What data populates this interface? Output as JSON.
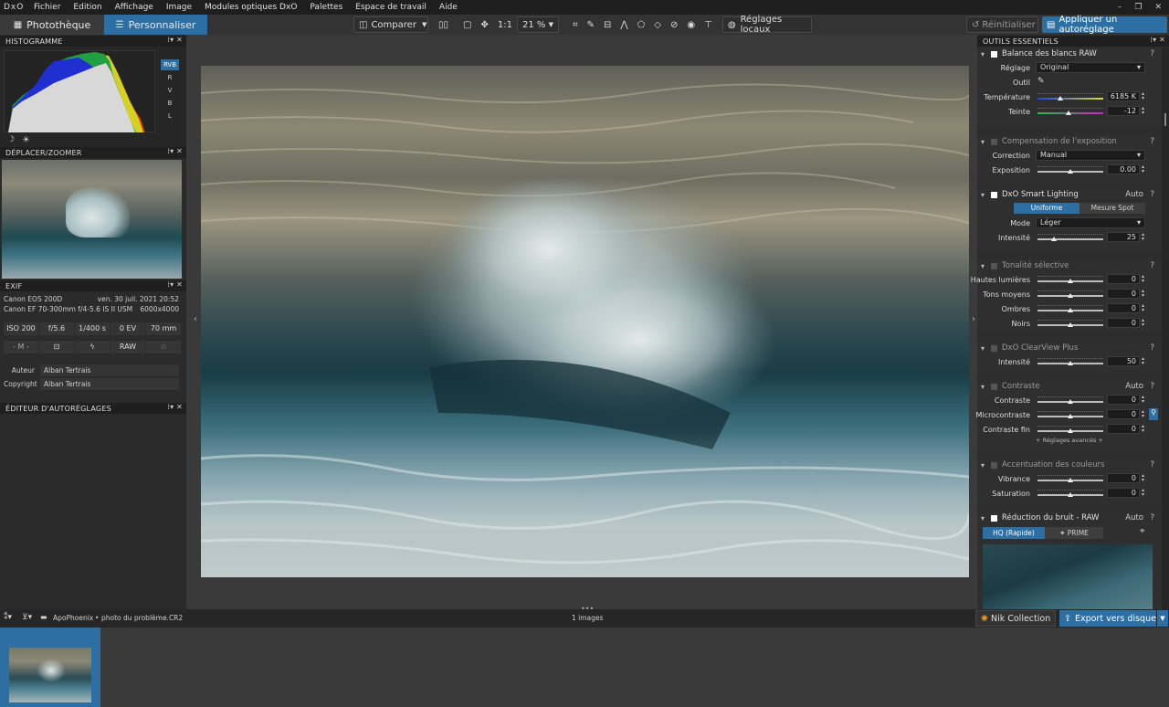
{
  "menubar": {
    "logo": "DxO",
    "items": [
      "Fichier",
      "Edition",
      "Affichage",
      "Image",
      "Modules optiques DxO",
      "Palettes",
      "Espace de travail",
      "Aide"
    ]
  },
  "toolbar": {
    "tab_library": "Photothèque",
    "tab_customize": "Personnaliser",
    "compare": "Comparer",
    "ratio": "1:1",
    "zoom": "21 %",
    "local_adjust": "Réglages locaux",
    "reset": "Réinitialiser",
    "apply_preset": "Appliquer un autoréglage"
  },
  "left": {
    "histogram_title": "HISTOGRAMME",
    "channels": [
      "RVB",
      "R",
      "V",
      "B",
      "L"
    ],
    "move_zoom_title": "DÉPLACER/ZOOMER",
    "exif_title": "EXIF",
    "camera": "Canon EOS 200D",
    "date": "ven. 30 juil. 2021 20:52",
    "lens": "Canon EF 70-300mm f/4-5.6 IS II USM",
    "size": "6000x4000",
    "iso": "ISO 200",
    "aperture": "f/5.6",
    "shutter": "1/400 s",
    "ev": "0 EV",
    "focal": "70 mm",
    "mode": "- M -",
    "format": "RAW",
    "author_label": "Auteur",
    "author": "Alban Tertrais",
    "copyright_label": "Copyright",
    "copyright": "Alban Tertrais",
    "preset_editor_title": "ÉDITEUR D'AUTORÉGLAGES"
  },
  "right": {
    "title": "OUTILS ESSENTIELS",
    "wb": {
      "title": "Balance des blancs RAW",
      "setting_label": "Réglage",
      "setting": "Original",
      "tool_label": "Outil",
      "temp_label": "Température",
      "temp": "6185 K",
      "tint_label": "Teinte",
      "tint": "-12",
      "temp_pos": 0.35,
      "tint_pos": 0.47
    },
    "exposure": {
      "title": "Compensation de l'exposition",
      "correction_label": "Correction",
      "correction": "Manual",
      "exposure_label": "Exposition",
      "exposure": "0.00",
      "pos": 0.5
    },
    "smart": {
      "title": "DxO Smart Lighting",
      "auto": "Auto",
      "uniform": "Uniforme",
      "spot": "Mesure Spot",
      "mode_label": "Mode",
      "mode": "Léger",
      "intensity_label": "Intensité",
      "intensity": "25",
      "pos": 0.25
    },
    "tonality": {
      "title": "Tonalité sélective",
      "rows": [
        {
          "label": "Hautes lumières",
          "value": "0"
        },
        {
          "label": "Tons moyens",
          "value": "0"
        },
        {
          "label": "Ombres",
          "value": "0"
        },
        {
          "label": "Noirs",
          "value": "0"
        }
      ]
    },
    "clearview": {
      "title": "DxO ClearView Plus",
      "intensity_label": "Intensité",
      "intensity": "50",
      "pos": 0.5
    },
    "contrast": {
      "title": "Contraste",
      "auto": "Auto",
      "rows": [
        {
          "label": "Contraste",
          "value": "0"
        },
        {
          "label": "Microcontraste",
          "value": "0"
        },
        {
          "label": "Contraste fin",
          "value": "0"
        }
      ],
      "advanced": "+ Réglages avancés +"
    },
    "color": {
      "title": "Accentuation des couleurs",
      "rows": [
        {
          "label": "Vibrance",
          "value": "0"
        },
        {
          "label": "Saturation",
          "value": "0"
        }
      ]
    },
    "noise": {
      "title": "Réduction du bruit - RAW",
      "auto": "Auto",
      "hq": "HQ (Rapide)",
      "prime": "✦ PRIME"
    }
  },
  "bottom": {
    "folder": "ApoPhoenix",
    "file": "photo du problème.CR2",
    "separator": "•",
    "count": "1 images",
    "nik": "Nik Collection",
    "export": "Export vers disque"
  },
  "colors": {
    "accent": "#2d6ea3",
    "tab_active": "#2d6ea3"
  }
}
